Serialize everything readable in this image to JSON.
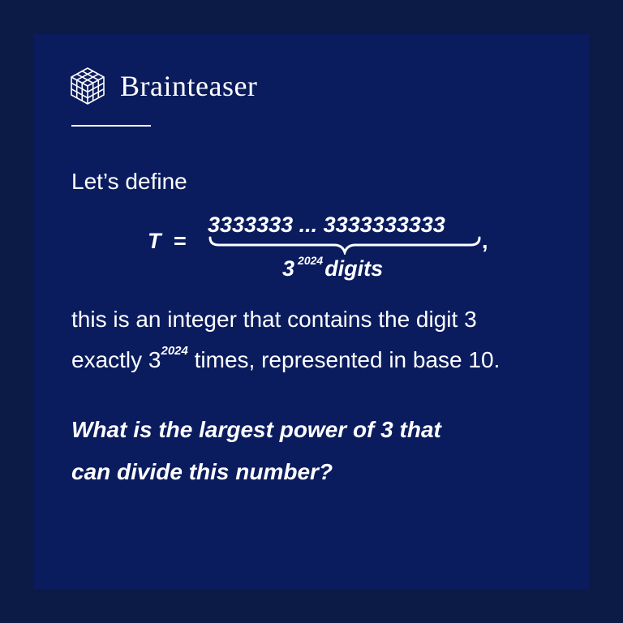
{
  "brand": {
    "name": "Brainteaser",
    "icon": "cube-grid-icon"
  },
  "colors": {
    "outer_background": "#0b1b45",
    "card_background": "#0a1c5e",
    "text": "#ffffff"
  },
  "body": {
    "intro": "Let’s define",
    "line1": "this is an integer that contains the digit 3",
    "line2_before": "exactly 3",
    "line2_exponent": "2024",
    "line2_after": "times, represented in base 10."
  },
  "formula": {
    "variable": "T",
    "equals": "=",
    "digits": "3333333 ... 3333333333",
    "comma": ",",
    "under_base": "3",
    "under_exponent": "2024",
    "under_label": "digits"
  },
  "question": {
    "line1": "What is the largest power of 3 that",
    "line2": "can divide this number?"
  }
}
